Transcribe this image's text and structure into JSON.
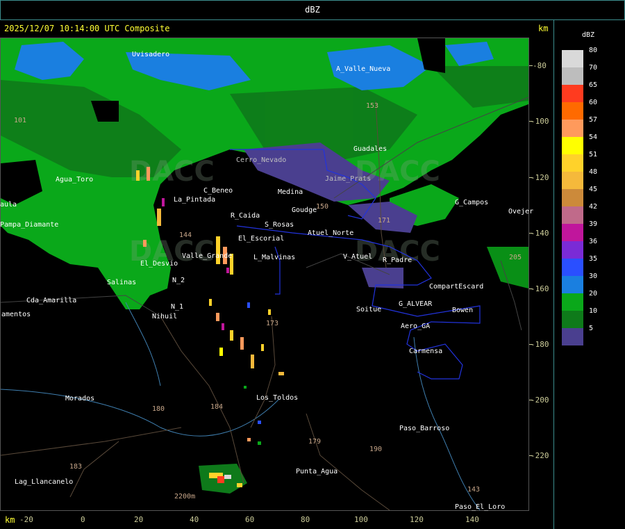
{
  "title": "dBZ",
  "header": "2025/12/07 10:14:00 UTC Composite",
  "axis_unit": "km",
  "y_ticks": [
    "-80",
    "-100",
    "-120",
    "-140",
    "-160",
    "-180",
    "-200",
    "-220"
  ],
  "x_ticks": [
    "-20",
    "0",
    "20",
    "40",
    "60",
    "80",
    "100",
    "120",
    "140"
  ],
  "legend": {
    "title": "dBZ",
    "levels": [
      {
        "label": "80",
        "color": "#d9d9d9"
      },
      {
        "label": "70",
        "color": "#bdbdbd"
      },
      {
        "label": "65",
        "color": "#ff3b1f"
      },
      {
        "label": "60",
        "color": "#ff6a00"
      },
      {
        "label": "57",
        "color": "#ff9a5c"
      },
      {
        "label": "54",
        "color": "#ffff00"
      },
      {
        "label": "51",
        "color": "#ffd22a"
      },
      {
        "label": "48",
        "color": "#f5b93b"
      },
      {
        "label": "45",
        "color": "#cc8a3a"
      },
      {
        "label": "42",
        "color": "#c06a8a"
      },
      {
        "label": "39",
        "color": "#c0169c"
      },
      {
        "label": "36",
        "color": "#7a2bd6"
      },
      {
        "label": "35",
        "color": "#2a4fff"
      },
      {
        "label": "30",
        "color": "#1a7fe0"
      },
      {
        "label": "20",
        "color": "#0aa81a"
      },
      {
        "label": "10",
        "color": "#0e7a1a"
      },
      {
        "label": "5",
        "color": "#4a3f8f"
      }
    ]
  },
  "watermark": "DACC",
  "places": [
    {
      "name": "Uvisadero"
    },
    {
      "name": "A_Valle_Nueva"
    },
    {
      "name": "Guadales"
    },
    {
      "name": "Agua_Toro"
    },
    {
      "name": "C_Beneo"
    },
    {
      "name": "R_Caida"
    },
    {
      "name": "S_Rosas"
    },
    {
      "name": "Goudge"
    },
    {
      "name": "Atuel_Norte"
    },
    {
      "name": "El_Escorial"
    },
    {
      "name": "L_Malvinas"
    },
    {
      "name": "Valle_Grande"
    },
    {
      "name": "El_Desvio"
    },
    {
      "name": "Salinas"
    },
    {
      "name": "Cda_Amarilla"
    },
    {
      "name": "amentos"
    },
    {
      "name": "N_1"
    },
    {
      "name": "N_2"
    },
    {
      "name": "Nihuil"
    },
    {
      "name": "V_Atuel"
    },
    {
      "name": "R_Padre"
    },
    {
      "name": "CompartEscard"
    },
    {
      "name": "G_ALVEAR"
    },
    {
      "name": "Soitue"
    },
    {
      "name": "Bowen"
    },
    {
      "name": "Aero_GA"
    },
    {
      "name": "Carmensa"
    },
    {
      "name": "Los_Toldos"
    },
    {
      "name": "Morados"
    },
    {
      "name": "Paso_Barroso"
    },
    {
      "name": "Punta_Agua"
    },
    {
      "name": "Lag_Llancanelo"
    },
    {
      "name": "Paso_El_Loro"
    },
    {
      "name": "G_Campos"
    },
    {
      "name": "Ovejer"
    },
    {
      "name": "Pampa_Diamante"
    },
    {
      "name": "aula"
    },
    {
      "name": "Cerro_Nevado"
    },
    {
      "name": "La_Pintada"
    },
    {
      "name": "Jaime_Prats"
    },
    {
      "name": "Medina"
    }
  ],
  "routes": [
    "153",
    "101",
    "144",
    "143",
    "184",
    "180",
    "179",
    "190",
    "183",
    "205",
    "171",
    "173",
    "150",
    "2200m"
  ]
}
